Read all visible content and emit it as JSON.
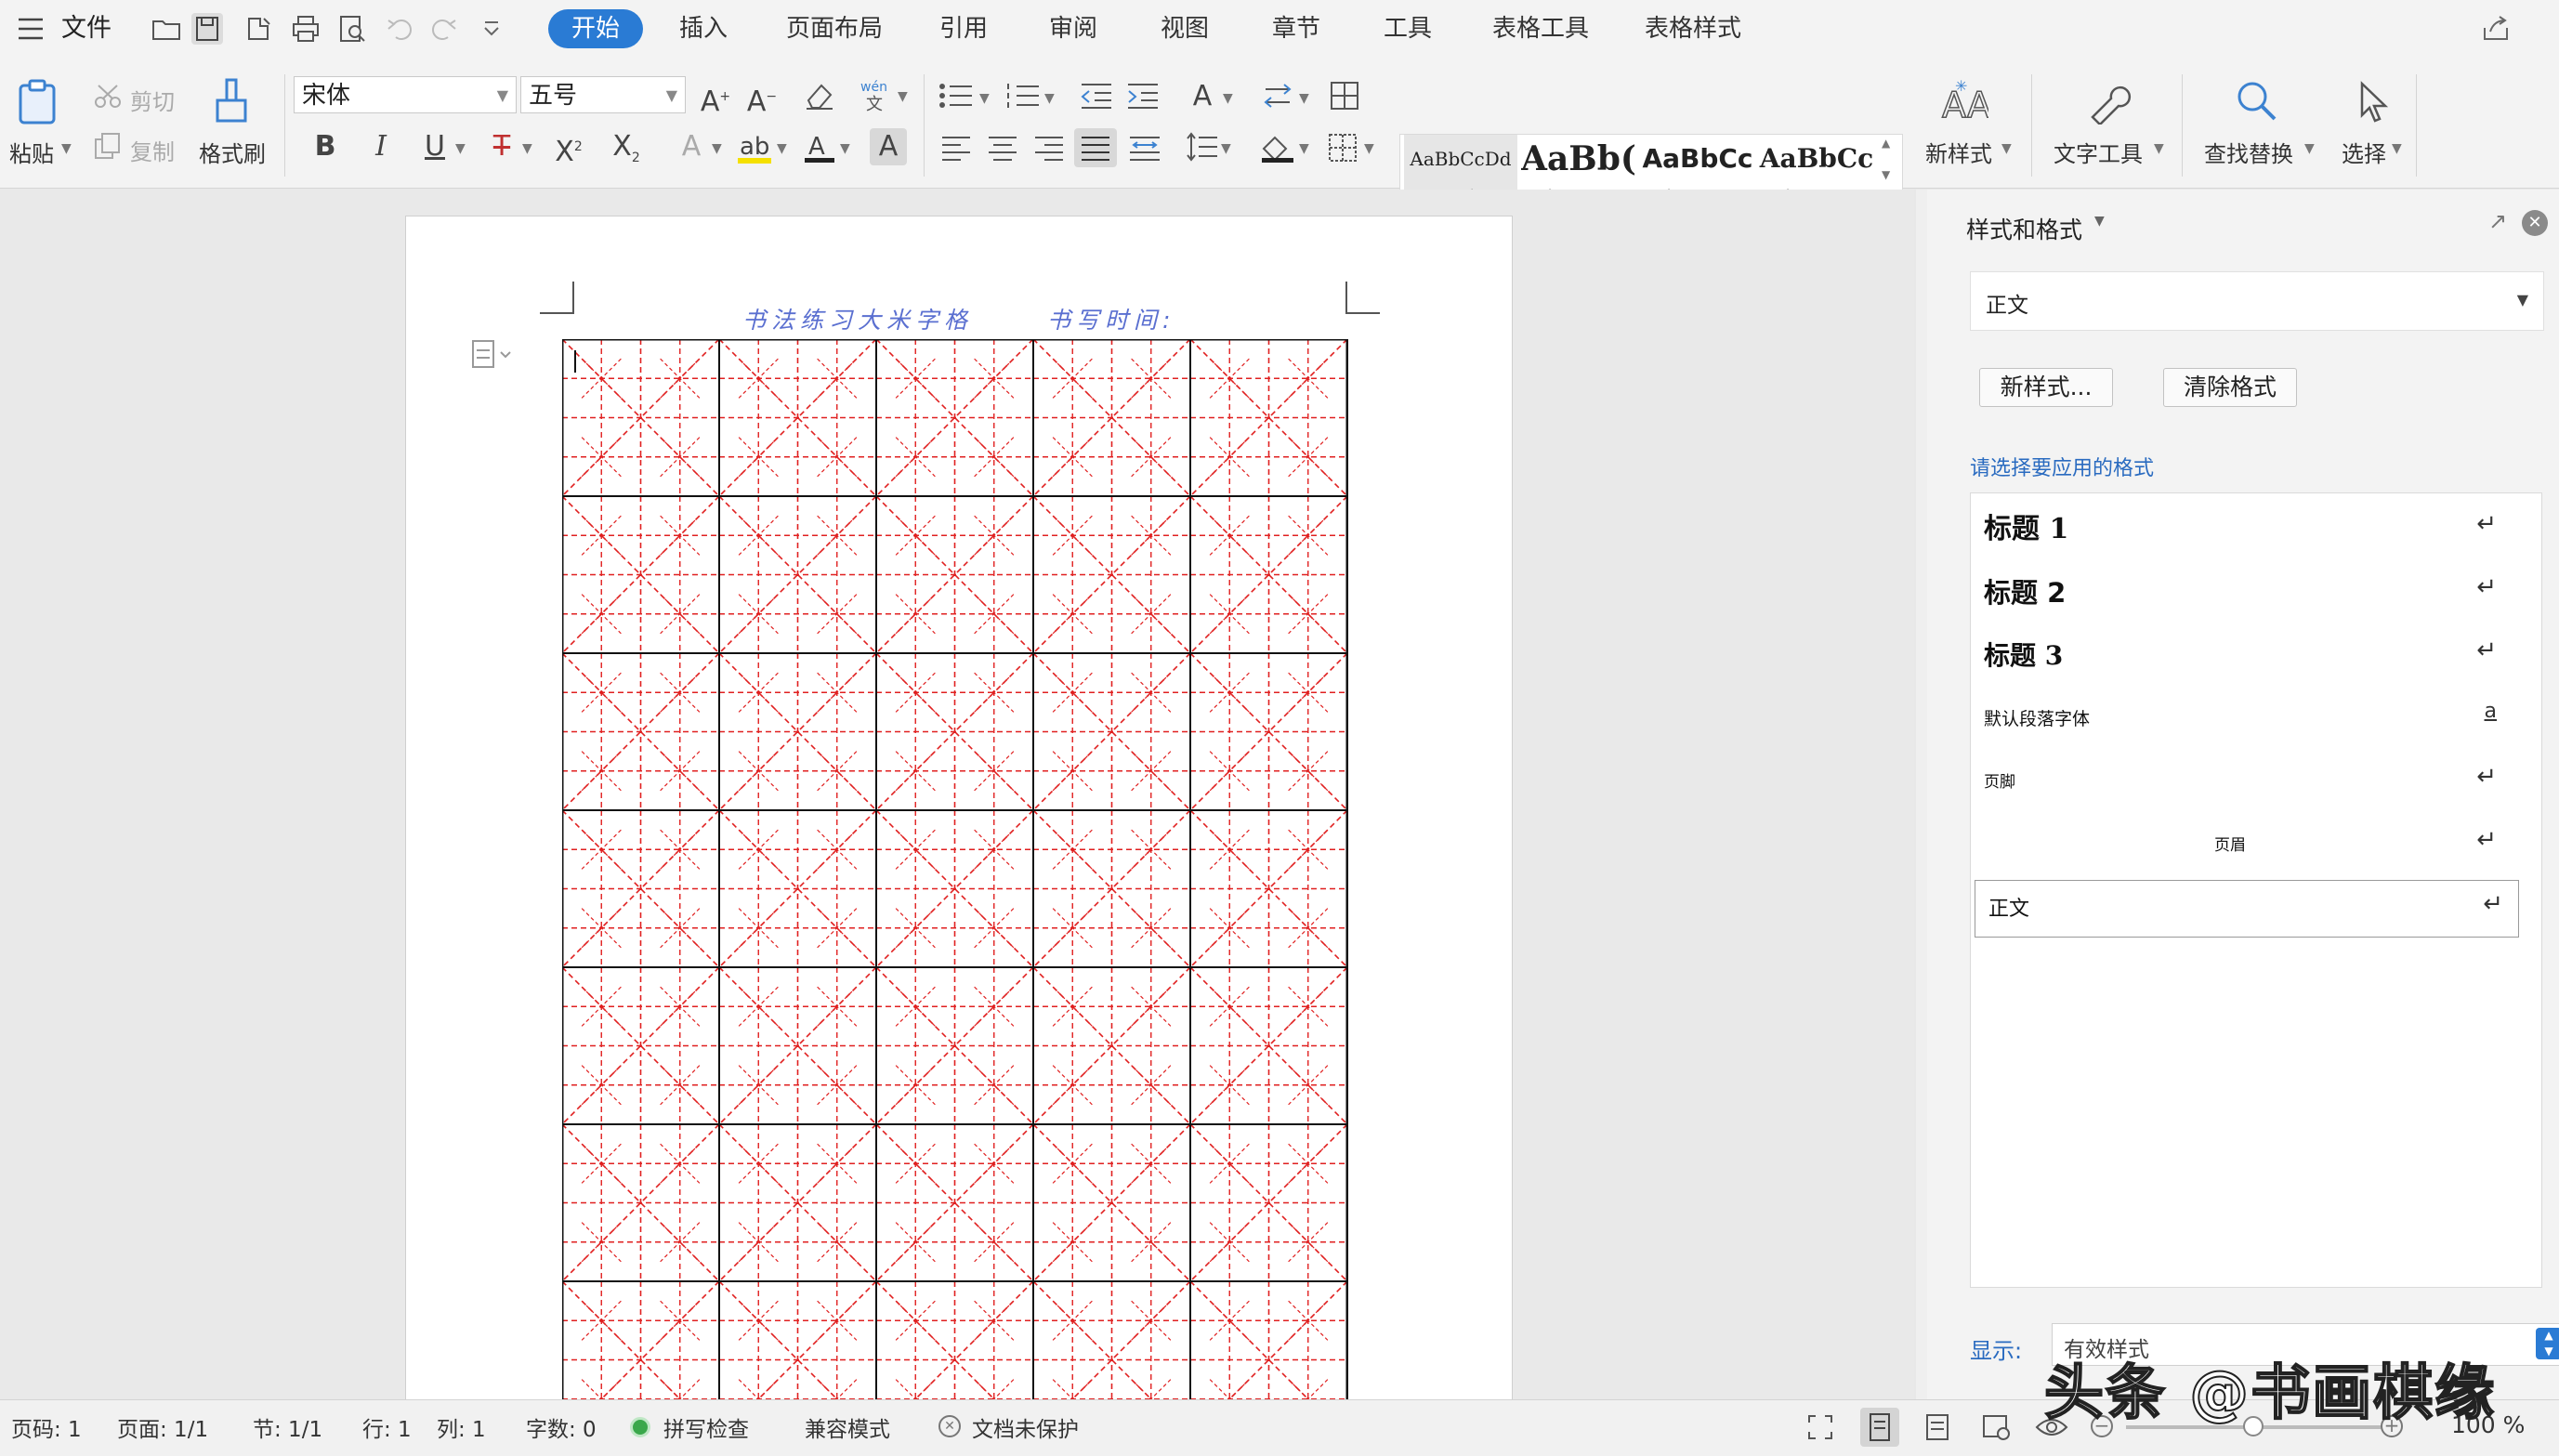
{
  "menubar": {
    "file": "文件",
    "tabs": [
      "开始",
      "插入",
      "页面布局",
      "引用",
      "审阅",
      "视图",
      "章节",
      "工具",
      "表格工具",
      "表格样式"
    ],
    "active_tab": "开始"
  },
  "ribbon": {
    "paste": "粘贴",
    "cut": "剪切",
    "copy": "复制",
    "format_painter": "格式刷",
    "font_name": "宋体",
    "font_size": "五号",
    "styles": [
      {
        "preview": "AaBbCcDd",
        "name": "正文"
      },
      {
        "preview": "AaBb(",
        "name": "标题 1"
      },
      {
        "preview": "AaBbCc",
        "name": "标题 2"
      },
      {
        "preview": "AaBbCc",
        "name": "标题 3"
      }
    ],
    "new_style": "新样式",
    "text_tools": "文字工具",
    "find_replace": "查找替换",
    "select": "选择"
  },
  "document": {
    "header_left": "书法练习大米字格",
    "header_right": "书写时间:"
  },
  "panel": {
    "title": "样式和格式",
    "current_style": "正文",
    "new_style_button": "新样式...",
    "clear_format_button": "清除格式",
    "hint": "请选择要应用的格式",
    "styles": [
      {
        "label": "标题 1",
        "mark": "↵"
      },
      {
        "label": "标题 2",
        "mark": "↵"
      },
      {
        "label": "标题 3",
        "mark": "↵"
      },
      {
        "label": "默认段落字体",
        "mark": "a"
      },
      {
        "label": "页脚",
        "mark": "↵"
      },
      {
        "label": "页眉",
        "mark": "↵"
      },
      {
        "label": "正文",
        "mark": "↵"
      }
    ],
    "show_label": "显示:",
    "show_value": "有效样式"
  },
  "statusbar": {
    "page_no": "页码: 1",
    "pages": "页面: 1/1",
    "section": "节: 1/1",
    "row": "行: 1",
    "col": "列: 1",
    "words": "字数: 0",
    "spell": "拼写检查",
    "compat": "兼容模式",
    "protect": "文档未保护",
    "zoom": "100 %",
    "zoom_level": 0.5
  },
  "watermark": "头条 @书画棋缘",
  "colors": {
    "accent": "#2a7bd4",
    "grid_red": "#e02020",
    "header_blue": "#5a6fd0"
  }
}
